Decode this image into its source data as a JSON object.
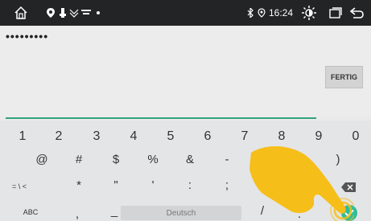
{
  "statusbar": {
    "time": "16:24",
    "icons": [
      "home-icon",
      "location-pin-icon",
      "usb-icon",
      "signal-icon",
      "bluetooth-icon",
      "gps-icon",
      "brightness-icon",
      "recent-apps-icon",
      "back-icon"
    ]
  },
  "content": {
    "password_mask": "•••••••••",
    "done_label": "FERTIG",
    "accent_color": "#33a27f"
  },
  "keyboard": {
    "numbers": [
      "1",
      "2",
      "3",
      "4",
      "5",
      "6",
      "7",
      "8",
      "9",
      "0"
    ],
    "row2": [
      "@",
      "#",
      "$",
      "%",
      "&",
      "-",
      "",
      ")"
    ],
    "row3_switch": "= \\ <",
    "row3": [
      "*",
      "\"",
      "'",
      ":",
      ";"
    ],
    "row4_abc": "ABC",
    "row4": [
      ",",
      "_",
      "/",
      "."
    ],
    "space_label": "Deutsch",
    "enter_color": "#2fbc9a"
  }
}
